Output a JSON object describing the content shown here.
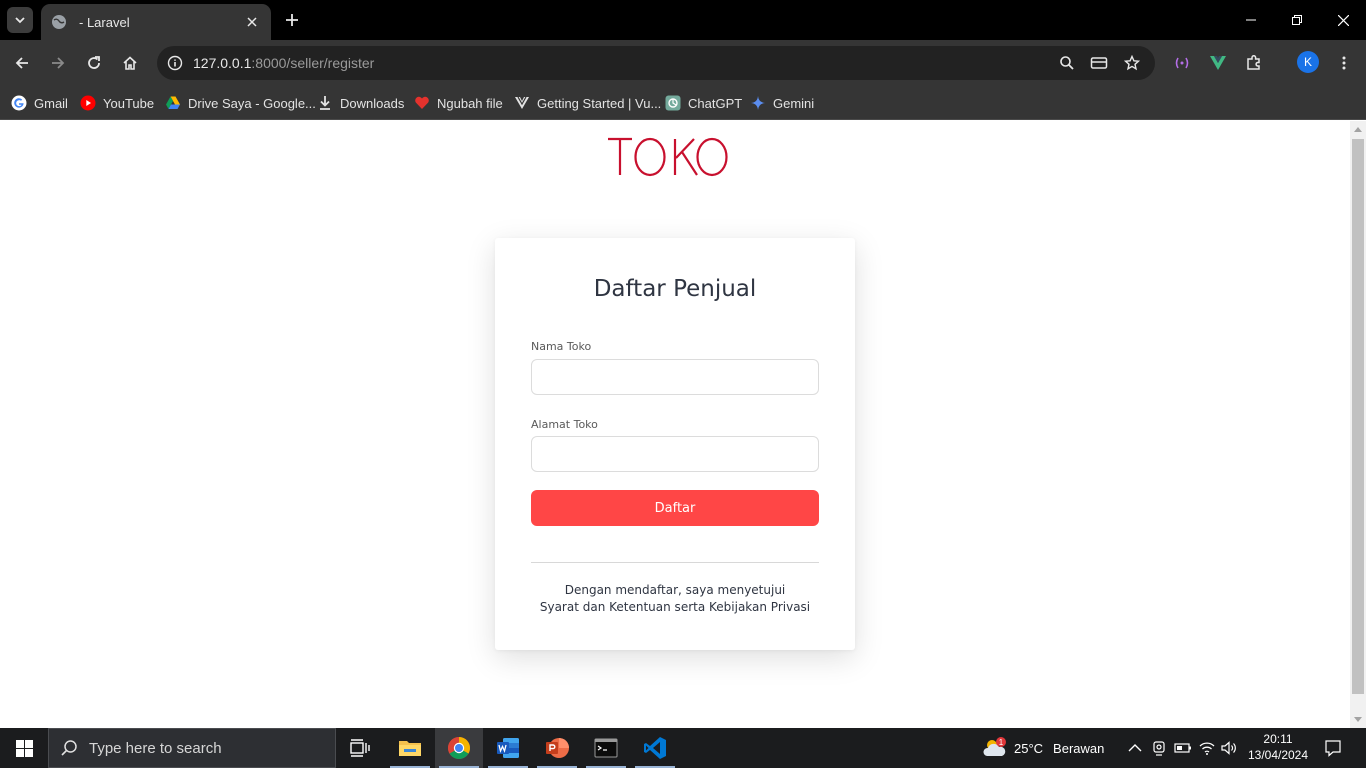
{
  "browser": {
    "tab_title": "- Laravel",
    "url_host": "127.0.0.1",
    "url_path": ":8000/seller/register",
    "profile_initial": "K",
    "bookmarks": [
      {
        "label": "Gmail",
        "icon": "gmail-icon"
      },
      {
        "label": "YouTube",
        "icon": "youtube-icon"
      },
      {
        "label": "Drive Saya - Google...",
        "icon": "google-drive-icon"
      },
      {
        "label": "Downloads",
        "icon": "download-icon"
      },
      {
        "label": "Ngubah file",
        "icon": "heart-icon"
      },
      {
        "label": "Getting Started | Vu...",
        "icon": "vuetify-icon"
      },
      {
        "label": "ChatGPT",
        "icon": "chatgpt-icon"
      },
      {
        "label": "Gemini",
        "icon": "gemini-icon"
      }
    ]
  },
  "page": {
    "logo_text": "TOKO",
    "form": {
      "title": "Daftar Penjual",
      "fields": [
        {
          "label": "Nama Toko",
          "value": ""
        },
        {
          "label": "Alamat Toko",
          "value": ""
        }
      ],
      "submit_label": "Daftar",
      "terms_line1": "Dengan mendaftar, saya menyetujui",
      "terms_line2": "Syarat dan Ketentuan serta Kebijakan Privasi"
    }
  },
  "taskbar": {
    "search_placeholder": "Type here to search",
    "weather_temp": "25°C",
    "weather_desc": "Berawan",
    "weather_badge": "1",
    "time": "20:11",
    "date": "13/04/2024"
  },
  "colors": {
    "brand": "#c8102e",
    "button": "#ff4646",
    "title": "#2f3542"
  }
}
